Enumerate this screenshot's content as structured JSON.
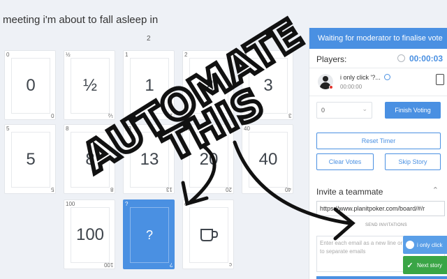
{
  "story": {
    "title": "meeting i'm about to fall asleep in",
    "vote_count": "2"
  },
  "cards": [
    {
      "value": "0",
      "corner": "0"
    },
    {
      "value": "½",
      "corner": "½"
    },
    {
      "value": "1",
      "corner": "1"
    },
    {
      "value": "2",
      "corner": "2"
    },
    {
      "value": "3",
      "corner": "3"
    },
    {
      "value": "5",
      "corner": "5"
    },
    {
      "value": "8",
      "corner": "8"
    },
    {
      "value": "13",
      "corner": "13"
    },
    {
      "value": "20",
      "corner": "20"
    },
    {
      "value": "40",
      "corner": "40"
    },
    {
      "value": "100",
      "corner": "100"
    },
    {
      "value": "?",
      "corner": "?",
      "selected": true
    },
    {
      "value": "coffee",
      "corner": "c",
      "icon": "coffee-cup-icon"
    }
  ],
  "panel": {
    "header": "Waiting for moderator to finalise vote",
    "players_label": "Players:",
    "timer": "00:00:03",
    "player": {
      "name": "i only click '?...",
      "time": "00:00:00"
    },
    "result_value": "0",
    "finish_label": "Finish Voting",
    "reset_label": "Reset Timer",
    "clear_label": "Clear Votes",
    "skip_label": "Skip Story",
    "invite_title": "Invite a teammate",
    "invite_url": "https://www.planitpoker.com/board/#/r",
    "invite_hint": "SEND INVITATIONS",
    "email_placeholder": "Enter each email as a new line or use commas to separate emails"
  },
  "toasts": {
    "info": "i only click",
    "ok": "Next story"
  },
  "overlay": {
    "line1": "AUTOMATE",
    "line2": "THIS"
  },
  "colors": {
    "accent": "#4a90e2",
    "success": "#3aa546",
    "background": "#eef1f6"
  }
}
